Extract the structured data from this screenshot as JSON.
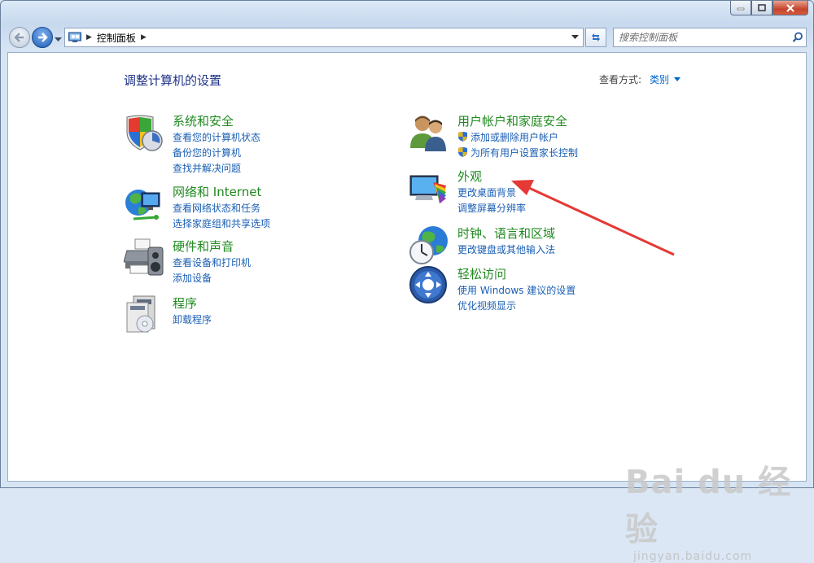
{
  "window": {
    "address": {
      "crumb": "控制面板"
    },
    "search": {
      "placeholder": "搜索控制面板"
    }
  },
  "page": {
    "title": "调整计算机的设置",
    "view_by_label": "查看方式:",
    "view_by_value": "类别"
  },
  "categories": [
    {
      "title": "系统和安全",
      "icon": "system-security-icon",
      "links": [
        "查看您的计算机状态",
        "备份您的计算机",
        "查找并解决问题"
      ]
    },
    {
      "title": "网络和 Internet",
      "icon": "network-internet-icon",
      "links": [
        "查看网络状态和任务",
        "选择家庭组和共享选项"
      ]
    },
    {
      "title": "硬件和声音",
      "icon": "hardware-sound-icon",
      "links": [
        "查看设备和打印机",
        "添加设备"
      ]
    },
    {
      "title": "程序",
      "icon": "programs-icon",
      "links": [
        "卸载程序"
      ]
    },
    {
      "title": "用户帐户和家庭安全",
      "icon": "user-accounts-icon",
      "links": [
        "添加或删除用户帐户",
        "为所有用户设置家长控制"
      ]
    },
    {
      "title": "外观",
      "icon": "appearance-icon",
      "links": [
        "更改桌面背景",
        "调整屏幕分辨率"
      ]
    },
    {
      "title": "时钟、语言和区域",
      "icon": "clock-region-icon",
      "links": [
        "更改键盘或其他输入法"
      ]
    },
    {
      "title": "轻松访问",
      "icon": "ease-of-access-icon",
      "links": [
        "使用 Windows 建议的设置",
        "优化视频显示"
      ]
    }
  ],
  "watermark": {
    "brand": "Bai du 经验",
    "url": "jingyan.baidu.com"
  },
  "colors": {
    "category_title": "#1f8a1f",
    "link": "#1a5fb4",
    "page_title": "#1e3287",
    "annotation_arrow": "#e53935"
  }
}
